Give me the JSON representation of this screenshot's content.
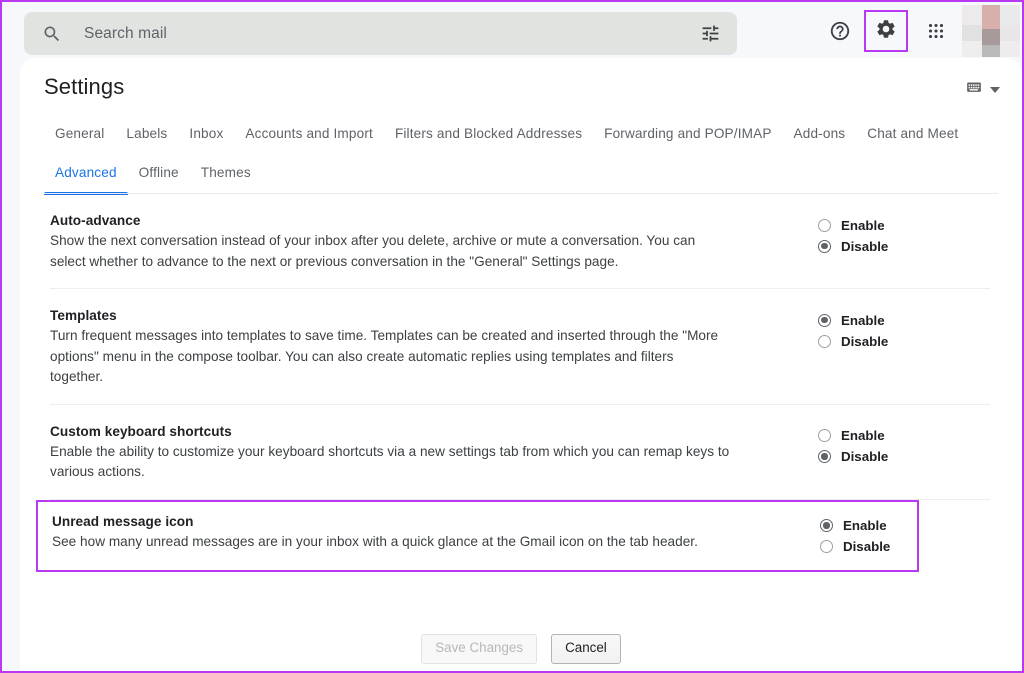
{
  "window": {
    "accent_highlight": "#b939f2",
    "link_color": "#1a73e8"
  },
  "topbar": {
    "search": {
      "placeholder": "Search mail",
      "value": "",
      "search_icon": "search-icon",
      "filter_icon": "tune-filter-icon"
    },
    "help_icon": "help-circle-icon",
    "settings_icon": "gear-icon",
    "apps_icon": "apps-grid-icon",
    "avatar": "user-avatar"
  },
  "page": {
    "title": "Settings",
    "density_icon": "keyboard-density-icon",
    "density_caret": "chevron-down-icon"
  },
  "tabs_row1": [
    {
      "label": "General",
      "active": false
    },
    {
      "label": "Labels",
      "active": false
    },
    {
      "label": "Inbox",
      "active": false
    },
    {
      "label": "Accounts and Import",
      "active": false
    },
    {
      "label": "Filters and Blocked Addresses",
      "active": false
    },
    {
      "label": "Forwarding and POP/IMAP",
      "active": false
    },
    {
      "label": "Add-ons",
      "active": false
    },
    {
      "label": "Chat and Meet",
      "active": false
    }
  ],
  "tabs_row2": [
    {
      "label": "Advanced",
      "active": true
    },
    {
      "label": "Offline",
      "active": false
    },
    {
      "label": "Themes",
      "active": false
    }
  ],
  "settings": [
    {
      "title": "Auto-advance",
      "description": "Show the next conversation instead of your inbox after you delete, archive or mute a conversation. You can select whether to advance to the next or previous conversation in the \"General\" Settings page.",
      "enable_label": "Enable",
      "disable_label": "Disable",
      "selected": "Disable",
      "highlighted": false
    },
    {
      "title": "Templates",
      "description": "Turn frequent messages into templates to save time. Templates can be created and inserted through the \"More options\" menu in the compose toolbar. You can also create automatic replies using templates and filters together.",
      "enable_label": "Enable",
      "disable_label": "Disable",
      "selected": "Enable",
      "highlighted": false
    },
    {
      "title": "Custom keyboard shortcuts",
      "description": "Enable the ability to customize your keyboard shortcuts via a new settings tab from which you can remap keys to various actions.",
      "enable_label": "Enable",
      "disable_label": "Disable",
      "selected": "Disable",
      "highlighted": false
    },
    {
      "title": "Unread message icon",
      "description": "See how many unread messages are in your inbox with a quick glance at the Gmail icon on the tab header.",
      "enable_label": "Enable",
      "disable_label": "Disable",
      "selected": "Enable",
      "highlighted": true
    }
  ],
  "footer": {
    "save_label": "Save Changes",
    "save_disabled": true,
    "cancel_label": "Cancel"
  }
}
